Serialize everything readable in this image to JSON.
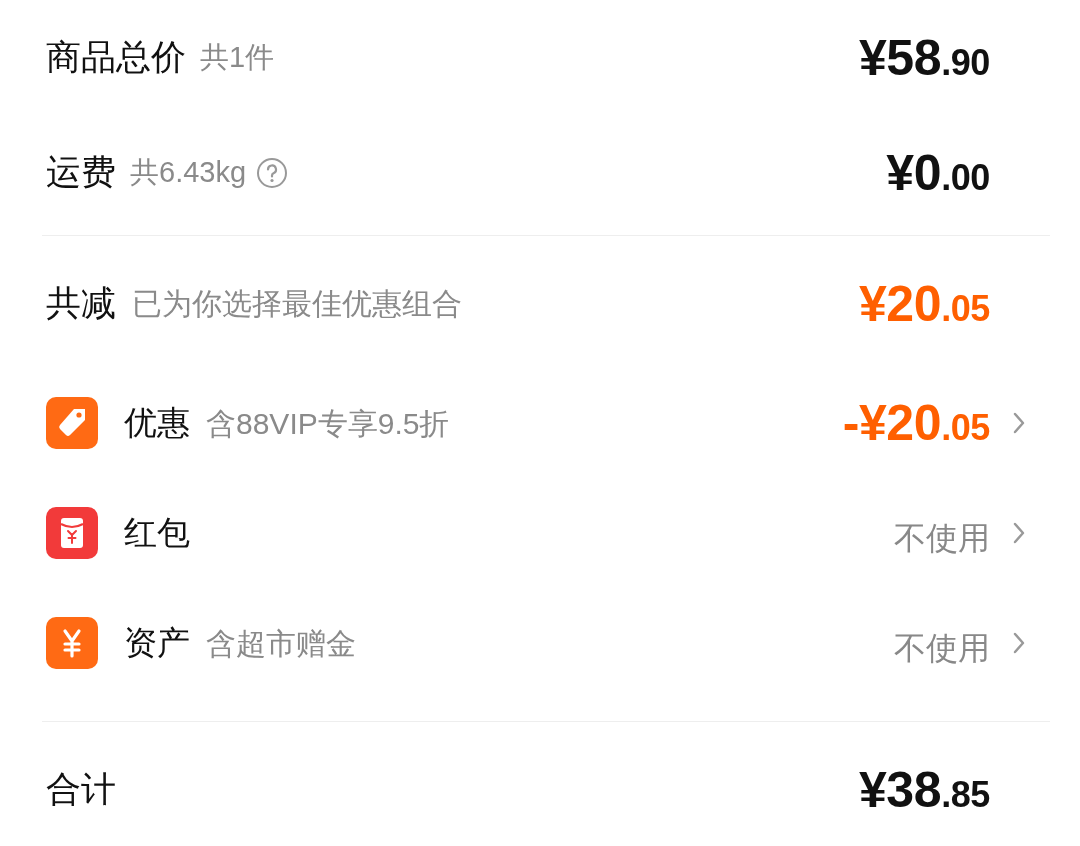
{
  "summary": [
    {
      "label": "商品总价",
      "note": "共1件",
      "help": false,
      "amount": "¥58.90"
    },
    {
      "label": "运费",
      "note": "共6.43kg",
      "help": true,
      "amount": "¥0.00"
    }
  ],
  "savings": {
    "label": "共减",
    "note": "已为你选择最佳优惠组合",
    "amount": "¥20.05"
  },
  "benefits": [
    {
      "kind": "discount",
      "label": "优惠",
      "note": "含88VIP专享9.5折",
      "amount": "-¥20.05"
    },
    {
      "kind": "red-packet",
      "label": "红包",
      "value": "不使用"
    },
    {
      "kind": "assets",
      "label": "资产",
      "note": "含超市赠金",
      "value": "不使用"
    }
  ],
  "total": {
    "label": "合计",
    "amount": "¥38.85"
  }
}
